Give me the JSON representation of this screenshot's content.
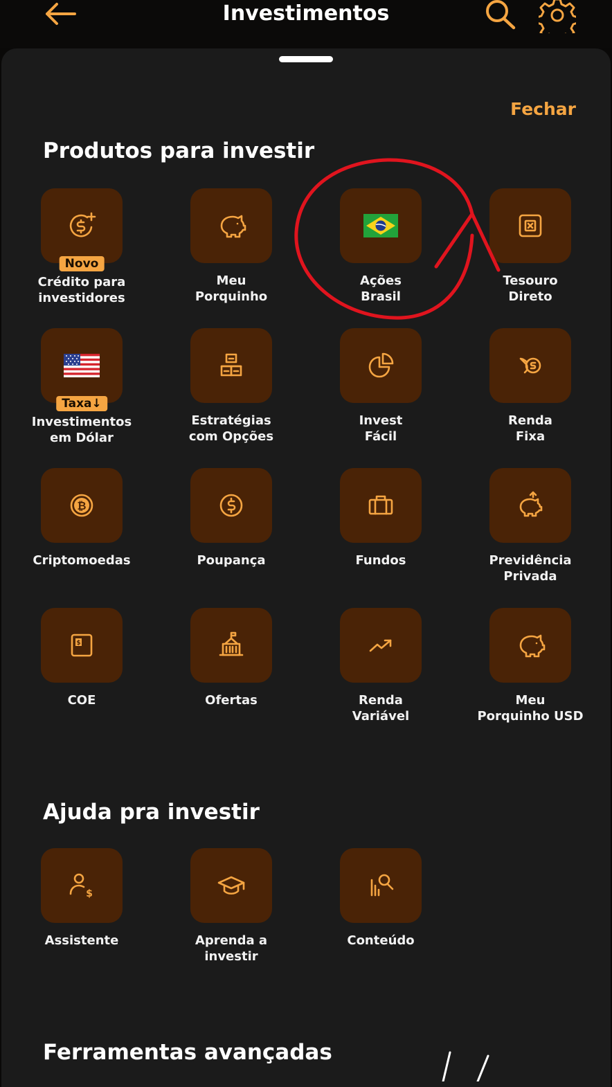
{
  "header": {
    "title": "Investimentos"
  },
  "sheet": {
    "close_label": "Fechar",
    "sections": [
      {
        "title": "Produtos para investir"
      },
      {
        "title": "Ajuda pra investir"
      },
      {
        "title": "Ferramentas avançadas"
      }
    ],
    "products": [
      {
        "label": "Crédito para\ninvestidores",
        "icon": "dollar-plus-icon",
        "badge": "Novo"
      },
      {
        "label": "Meu\nPorquinho",
        "icon": "piggy-bank-icon"
      },
      {
        "label": "Ações\nBrasil",
        "icon": "brazil-flag-icon"
      },
      {
        "label": "Tesouro\nDireto",
        "icon": "safe-icon"
      },
      {
        "label": "Investimentos\nem Dólar",
        "icon": "usa-flag-icon",
        "badge": "Taxa↓"
      },
      {
        "label": "Estratégias\ncom Opções",
        "icon": "blocks-icon"
      },
      {
        "label": "Invest\nFácil",
        "icon": "pie-chart-icon"
      },
      {
        "label": "Renda\nFixa",
        "icon": "hand-coin-icon"
      },
      {
        "label": "Criptomoedas",
        "icon": "bitcoin-icon"
      },
      {
        "label": "Poupança",
        "icon": "dollar-coin-icon"
      },
      {
        "label": "Fundos",
        "icon": "briefcase-icon"
      },
      {
        "label": "Previdência\nPrivada",
        "icon": "piggy-arrow-icon"
      },
      {
        "label": "COE",
        "icon": "dollar-card-icon"
      },
      {
        "label": "Ofertas",
        "icon": "building-flag-icon"
      },
      {
        "label": "Renda\nVariável",
        "icon": "trend-up-icon"
      },
      {
        "label": "Meu\nPorquinho USD",
        "icon": "piggy-usd-icon"
      }
    ],
    "help": [
      {
        "label": "Assistente",
        "icon": "person-dollar-icon"
      },
      {
        "label": "Aprenda a\ninvestir",
        "icon": "graduation-cap-icon"
      },
      {
        "label": "Conteúdo",
        "icon": "chart-search-icon"
      }
    ]
  },
  "colors": {
    "accent": "#f5a542",
    "tile_bg": "#4a2306",
    "sheet_bg": "#1b1b1b",
    "annotation": "#e0141e"
  }
}
